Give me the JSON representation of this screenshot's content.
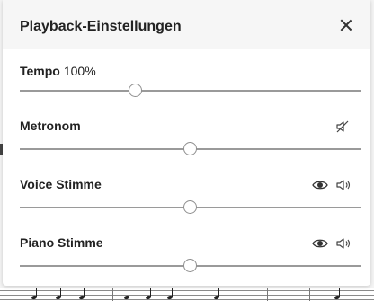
{
  "dialog": {
    "title": "Playback-Einstellungen",
    "close_icon": "close-icon"
  },
  "tempo": {
    "name": "Tempo",
    "value": "100%",
    "slider_level": 0.34
  },
  "metronome": {
    "name": "Metronom",
    "icon": "speaker-muted-icon",
    "slider_level": 0.5
  },
  "voice": {
    "name": "Voice Stimme",
    "icons": [
      "eye-icon",
      "speaker-icon"
    ],
    "slider_level": 0.5
  },
  "piano": {
    "name": "Piano Stimme",
    "icons": [
      "eye-icon",
      "speaker-icon"
    ],
    "slider_level": 0.5
  }
}
